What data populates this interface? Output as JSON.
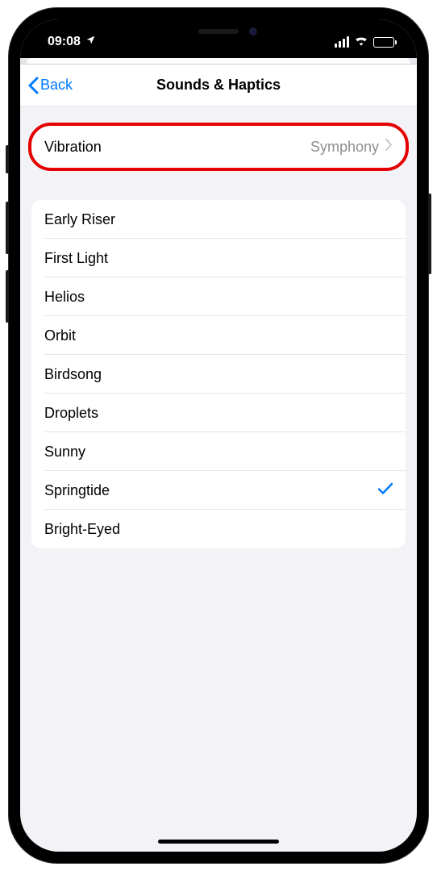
{
  "status": {
    "time": "09:08"
  },
  "nav": {
    "back_label": "Back",
    "title": "Sounds & Haptics"
  },
  "vibration": {
    "label": "Vibration",
    "value": "Symphony"
  },
  "sounds": {
    "items": [
      {
        "label": "Early Riser",
        "selected": false
      },
      {
        "label": "First Light",
        "selected": false
      },
      {
        "label": "Helios",
        "selected": false
      },
      {
        "label": "Orbit",
        "selected": false
      },
      {
        "label": "Birdsong",
        "selected": false
      },
      {
        "label": "Droplets",
        "selected": false
      },
      {
        "label": "Sunny",
        "selected": false
      },
      {
        "label": "Springtide",
        "selected": true
      },
      {
        "label": "Bright-Eyed",
        "selected": false
      }
    ]
  },
  "colors": {
    "accent": "#007aff",
    "highlight": "#e30000",
    "secondary": "#8e8e93",
    "background": "#f2f2f7"
  }
}
